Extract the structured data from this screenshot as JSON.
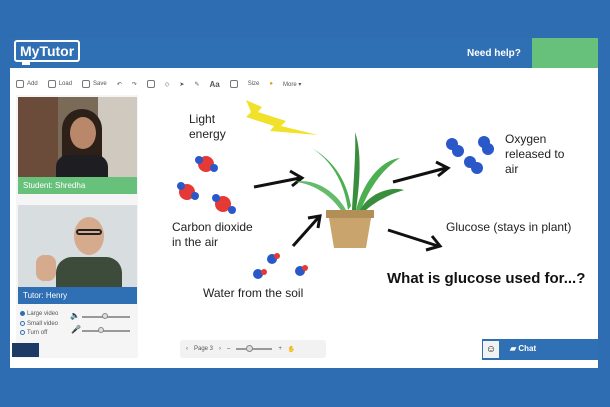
{
  "app": {
    "logo": "MyTutor",
    "help": "Need help?"
  },
  "toolbar": {
    "items": [
      "Add",
      "Load",
      "Save",
      "Aa",
      "Size",
      "More"
    ]
  },
  "student": {
    "label": "Student: Shredha"
  },
  "tutor": {
    "label": "Tutor: Henry"
  },
  "video_options": [
    "Large video",
    "Small video",
    "Turn off"
  ],
  "pager": {
    "label": "Page 3"
  },
  "chat": {
    "label": "Chat"
  },
  "whiteboard": {
    "light": "Light\nenergy",
    "co2": "Carbon dioxide\nin the air",
    "water": "Water from the soil",
    "oxygen": "Oxygen\nreleased to\nair",
    "glucose": "Glucose (stays in plant)",
    "question": "What is glucose used for...?"
  },
  "colors": {
    "brand": "#2f6fb4",
    "green": "#67c17a",
    "red_atom": "#e53935",
    "blue_atom": "#2a58c9"
  }
}
